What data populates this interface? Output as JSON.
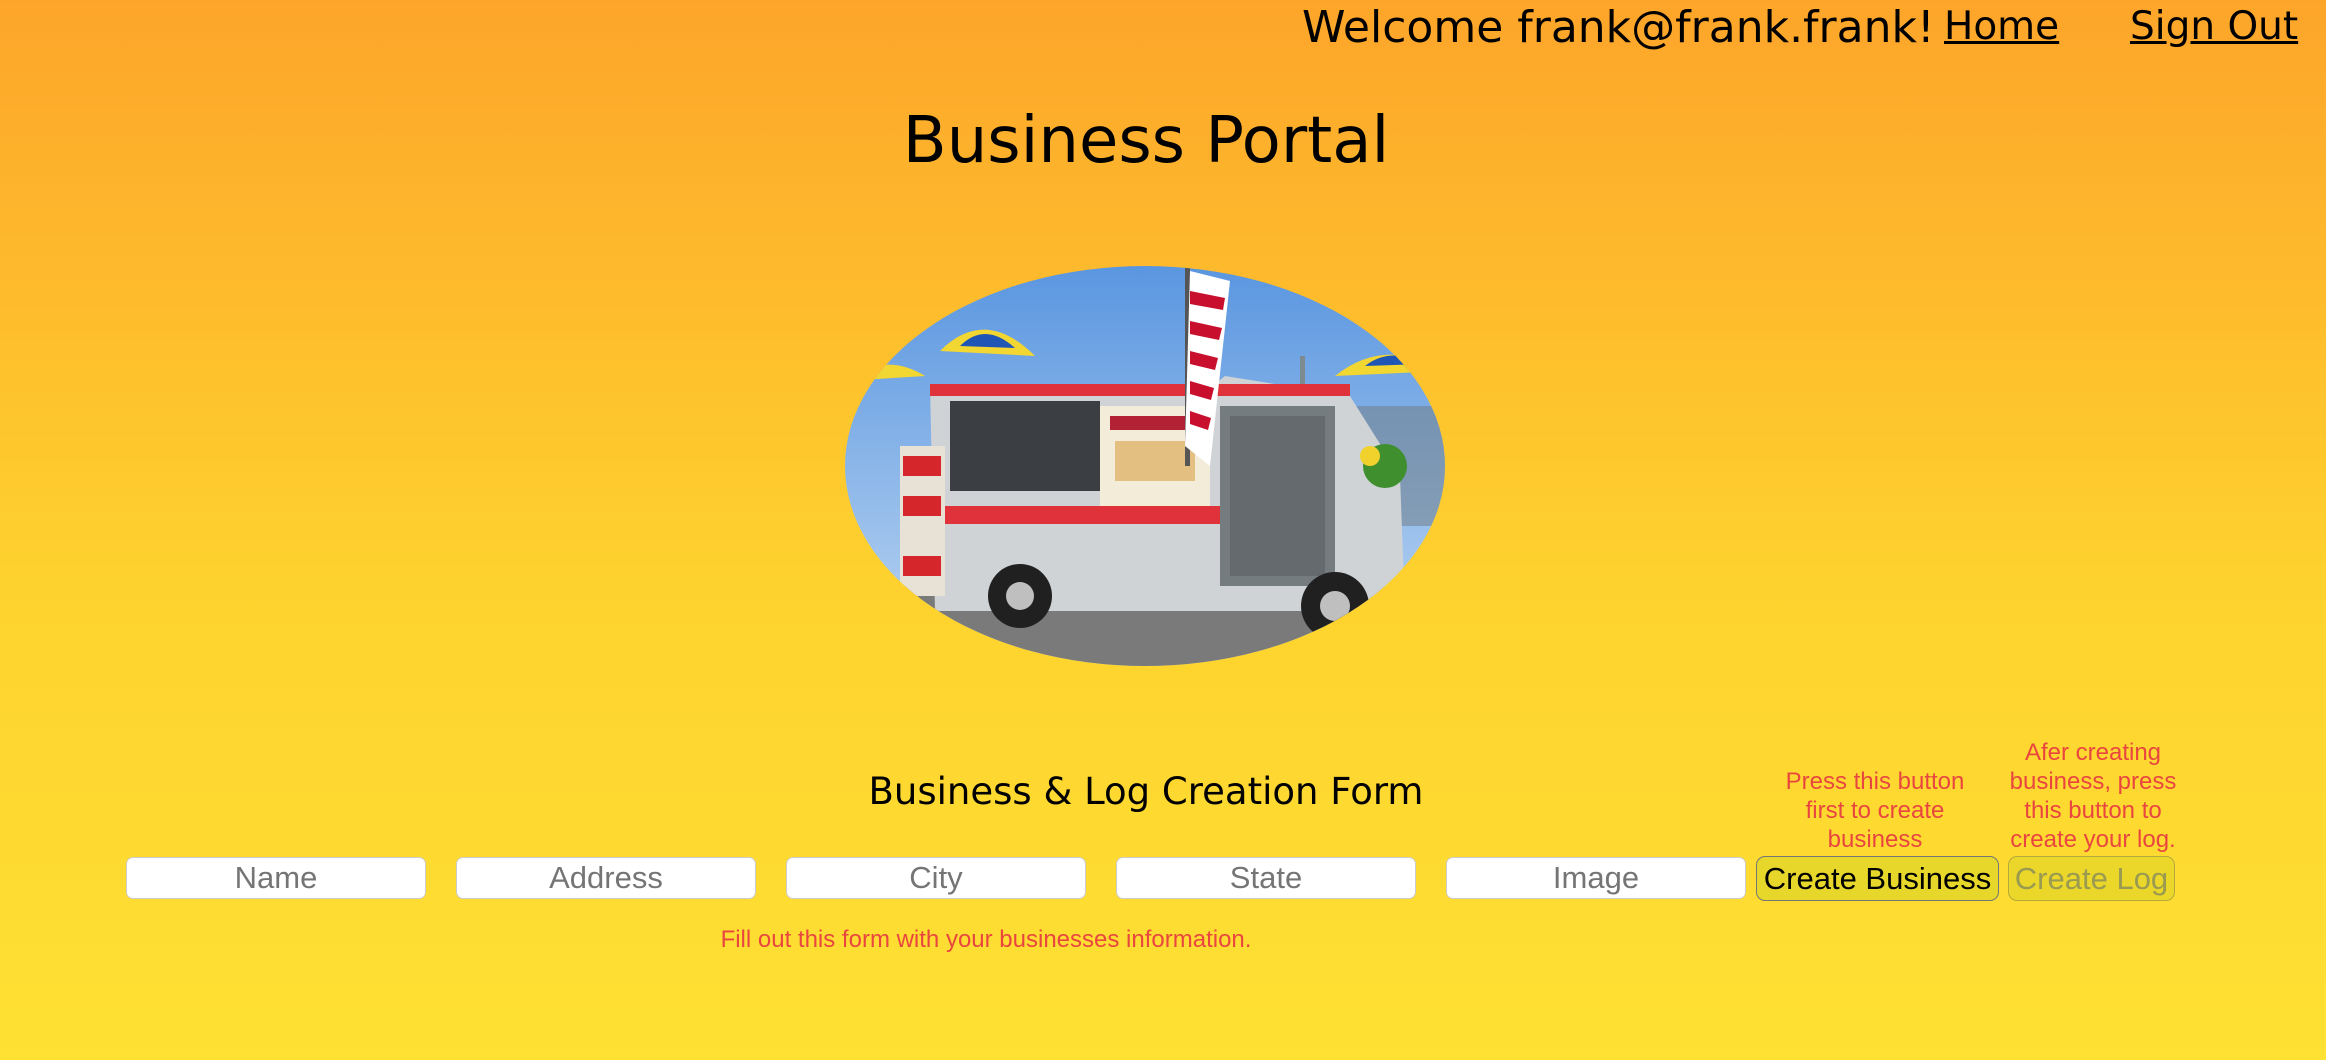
{
  "header": {
    "welcome": "Welcome frank@frank.frank!",
    "home_label": "Home",
    "signout_label": "Sign Out"
  },
  "page_title": "Business Portal",
  "hero_image": {
    "icon": "food-truck-photo"
  },
  "form": {
    "title": "Business & Log Creation Form",
    "fields": [
      {
        "placeholder": "Name",
        "value": ""
      },
      {
        "placeholder": "Address",
        "value": ""
      },
      {
        "placeholder": "City",
        "value": ""
      },
      {
        "placeholder": "State",
        "value": ""
      },
      {
        "placeholder": "Image",
        "value": ""
      }
    ],
    "create_business_label": "Create Business",
    "create_log_label": "Create Log",
    "create_business_hint": "Press this button first to create business",
    "create_log_hint": "Afer creating business, press this button to create your log.",
    "footer_hint": "Fill out this form with your businesses information."
  },
  "colors": {
    "background_top": "#fda52a",
    "background_bottom": "#fee133",
    "hint_red": "#e9463f",
    "button_yellow": "#e6d72a"
  }
}
